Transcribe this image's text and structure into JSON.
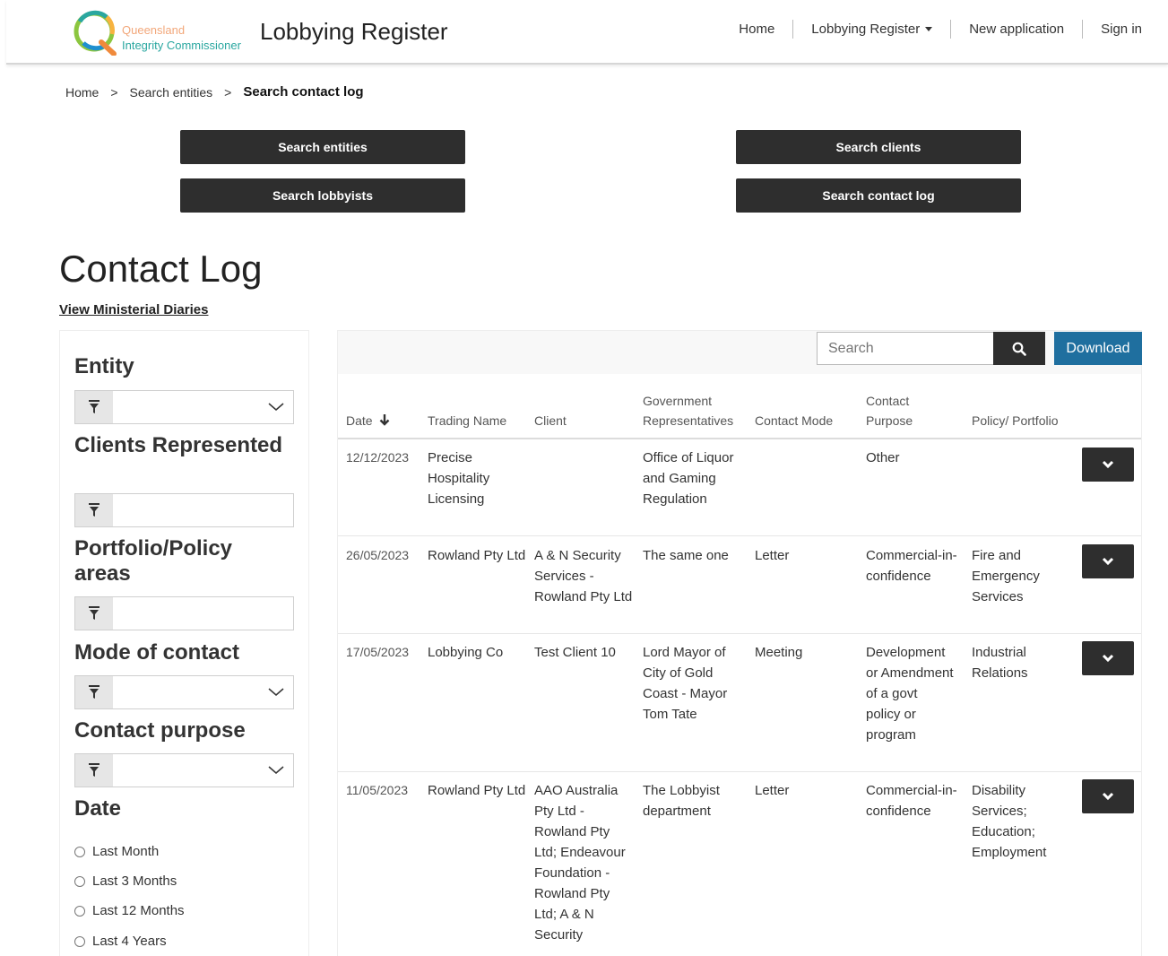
{
  "header": {
    "logo_line1": "Queensland",
    "logo_line2": "Integrity Commissioner",
    "site_title": "Lobbying Register",
    "nav": {
      "home": "Home",
      "register": "Lobbying Register",
      "new_application": "New application",
      "sign_in": "Sign in"
    }
  },
  "breadcrumb": {
    "home": "Home",
    "search_entities": "Search entities",
    "current": "Search contact log",
    "separator": ">"
  },
  "top_buttons": {
    "search_entities": "Search entities",
    "search_clients": "Search clients",
    "search_lobbyists": "Search lobbyists",
    "search_contact_log": "Search contact log"
  },
  "page": {
    "title": "Contact Log",
    "diaries_link": "View Ministerial Diaries"
  },
  "filters": {
    "entity": "Entity",
    "clients": "Clients Represented",
    "portfolio": "Portfolio/Policy areas",
    "mode": "Mode of contact",
    "purpose": "Contact purpose",
    "date": "Date",
    "date_options": [
      "Last Month",
      "Last 3 Months",
      "Last 12 Months",
      "Last 4 Years"
    ]
  },
  "toolbar": {
    "search_placeholder": "Search",
    "download": "Download"
  },
  "table": {
    "headers": {
      "date": "Date",
      "trading_name": "Trading Name",
      "client": "Client",
      "gov_reps_1": "Government",
      "gov_reps_2": "Representatives",
      "contact_mode": "Contact Mode",
      "purpose_1": "Contact",
      "purpose_2": "Purpose",
      "policy": "Policy/ Portfolio"
    },
    "rows": [
      {
        "date": "12/12/2023",
        "trading_name": "Precise Hospitality Licensing",
        "client": "",
        "gov_reps": "Office of Liquor and Gaming Regulation",
        "mode": "",
        "purpose": "Other",
        "policy": ""
      },
      {
        "date": "26/05/2023",
        "trading_name": "Rowland Pty Ltd",
        "client": "A & N Security Services - Rowland Pty Ltd",
        "gov_reps": "The same one",
        "mode": "Letter",
        "purpose": "Commercial-in-confidence",
        "policy": "Fire and Emergency Services"
      },
      {
        "date": "17/05/2023",
        "trading_name": "Lobbying Co",
        "client": "Test Client 10",
        "gov_reps": "Lord Mayor of City of Gold Coast - Mayor Tom Tate",
        "mode": "Meeting",
        "purpose": "Development or Amendment of a govt policy or program",
        "policy": "Industrial Relations"
      },
      {
        "date": "11/05/2023",
        "trading_name": "Rowland Pty Ltd",
        "client": "AAO Australia Pty Ltd - Rowland Pty Ltd; Endeavour Foundation - Rowland Pty Ltd; A & N Security",
        "gov_reps": "The Lobbyist department",
        "mode": "Letter",
        "purpose": "Commercial-in-confidence",
        "policy": "Disability Services; Education; Employment"
      }
    ]
  },
  "colors": {
    "dark_button": "#2e2e2e",
    "download_button": "#1f6f9f",
    "logo_orange": "#f2a77a",
    "logo_teal": "#2aa7a0"
  }
}
